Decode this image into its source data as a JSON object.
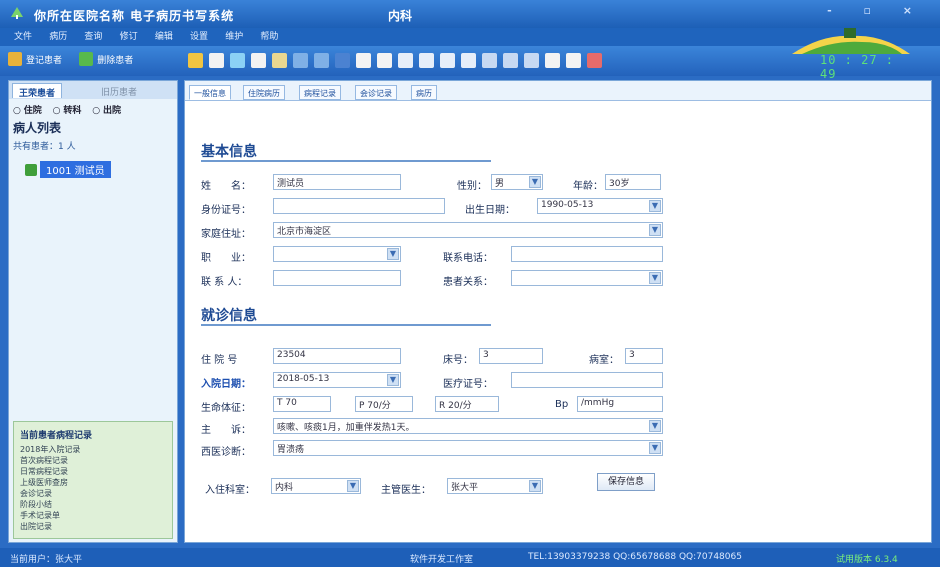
{
  "window": {
    "title": "你所在医院名称 电子病历书写系统",
    "department": "内科",
    "controls": "- ▫ ×"
  },
  "menu": [
    "文件",
    "病历",
    "查询",
    "修订",
    "编辑",
    "设置",
    "维护",
    "帮助"
  ],
  "toolbar": {
    "buttons": [
      "登记患者",
      "删除患者"
    ]
  },
  "clock": "10 : 27 : 49",
  "sidebar": {
    "tab_active": "王荣患者",
    "tab_inactive": "旧历患者",
    "radios": [
      "住院",
      "转科",
      "出院"
    ],
    "list_title": "病人列表",
    "count_text": "共有患者：1 人",
    "tree_node": "1001 测试员",
    "spec_title": "当前患者病程记录",
    "spec_lines": [
      "2018年入院记录",
      "首次病程记录",
      "日常病程记录",
      "上级医师查房",
      "会诊记录",
      "阶段小结",
      "手术记录单",
      "出院记录"
    ]
  },
  "tabs": [
    "一般信息",
    "住院病历",
    "病程记录",
    "会诊记录",
    "病历"
  ],
  "basic": {
    "title": "基本信息",
    "name_label": "姓　　名：",
    "name_value": "测试员",
    "gender_label": "性别：",
    "gender_value": "男",
    "age_label": "年龄：",
    "age_value": "30岁",
    "id_label": "身份证号：",
    "id_value": "",
    "birth_label": "出生日期：",
    "birth_value": "1990-05-13",
    "address_label": "家庭住址：",
    "address_value": "北京市海淀区",
    "job_label": "职　　业：",
    "job_value": "",
    "phone_label": "联系电话：",
    "phone_value": "",
    "contact_label": "联 系 人：",
    "contact_value": "",
    "relation_label": "患者关系：",
    "relation_value": ""
  },
  "admit": {
    "title": "就诊信息",
    "case_no_label": "住 院 号",
    "case_no_value": "23504",
    "bed_label": "床号：",
    "bed_value": "3",
    "room_label": "病室：",
    "room_value": "3",
    "date_label": "入院日期：",
    "date_value": "2018-05-13",
    "cert_label": "医疗证号：",
    "cert_value": "",
    "vital_label": "生命体征：",
    "t_value": "T 70",
    "p_value": "P 70/分",
    "r_value": "R 20/分",
    "bp_label": "Bp",
    "bp_value": "/mmHg",
    "complaint_label": "主　　诉：",
    "complaint_value": "咳嗽、咳痰1月，加重伴发热1天。",
    "diag_label": "西医诊断：",
    "diag_value": "胃溃疡",
    "dept_label": "入住科室：",
    "dept_value": "内科",
    "doctor_label": "主管医生：",
    "doctor_value": "张大平",
    "save_label": "保存信息"
  },
  "status": {
    "user": "当前用户：张大平",
    "company": "软件开发工作室",
    "contact": "TEL:13903379238  QQ:65678688  QQ:70748065",
    "version": "试用版本 6.3.4"
  }
}
